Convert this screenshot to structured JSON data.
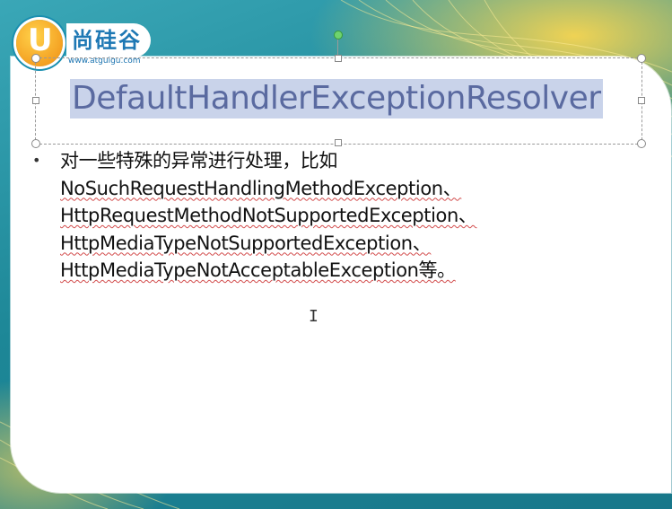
{
  "slide": {
    "title": "DefaultHandlerExceptionResolver",
    "bullet_symbol": "•",
    "lines": [
      {
        "text": "对一些特殊的异常进行处理，比如",
        "misspelled": false
      },
      {
        "text": "NoSuchRequestHandlingMethodException、",
        "misspelled": true
      },
      {
        "text": "HttpRequestMethodNotSupportedException、",
        "misspelled": true
      },
      {
        "text": "HttpMediaTypeNotSupportedException、",
        "misspelled": true
      },
      {
        "text": "HttpMediaTypeNotAcceptableException等。",
        "misspelled": true
      }
    ]
  },
  "logo": {
    "letter": "U",
    "brand": "尚硅谷",
    "url": "www.atguigu.com"
  },
  "cursor": "I",
  "colors": {
    "background_teal": "#1e8d9c",
    "title_highlight": "#c9d3ea",
    "title_text": "#5a6aa0",
    "spell_underline": "#d24c4c",
    "logo_orange": "#f08c12",
    "logo_blue": "#1e78b4"
  }
}
